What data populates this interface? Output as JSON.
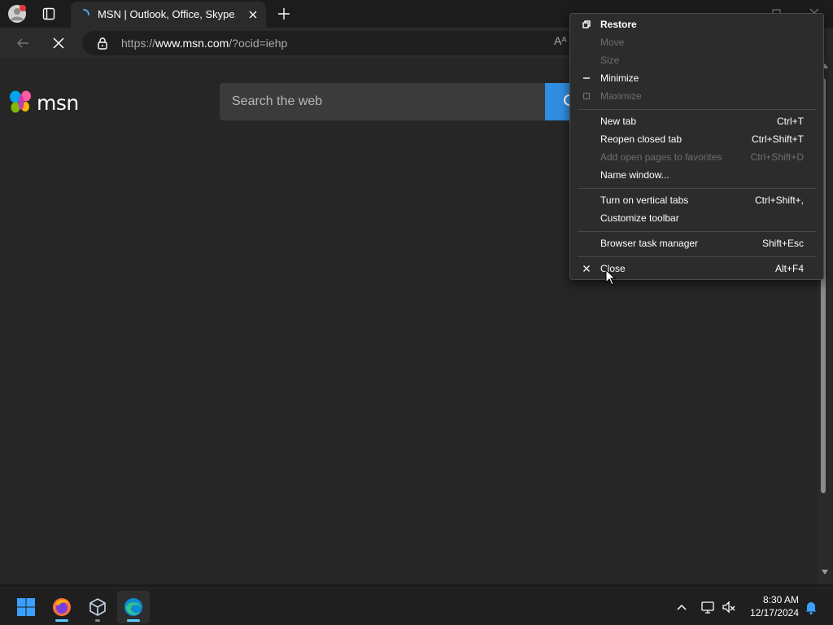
{
  "browser": {
    "tab": {
      "title": "MSN | Outlook, Office, Skype, Bing"
    },
    "address": {
      "prefix": "https://",
      "domain": "www.msn.com",
      "path": "/?ocid=iehp"
    },
    "read_aloud_glyph": "Aᴬ"
  },
  "page": {
    "logo_text": "msn",
    "search_placeholder": "Search the web"
  },
  "context_menu": {
    "restore": "Restore",
    "move": "Move",
    "size": "Size",
    "minimize": "Minimize",
    "maximize": "Maximize",
    "new_tab": {
      "label": "New tab",
      "shortcut": "Ctrl+T"
    },
    "reopen_closed_tab": {
      "label": "Reopen closed tab",
      "shortcut": "Ctrl+Shift+T"
    },
    "add_open_pages": {
      "label": "Add open pages to favorites",
      "shortcut": "Ctrl+Shift+D"
    },
    "name_window": {
      "label": "Name window..."
    },
    "vertical_tabs": {
      "label": "Turn on vertical tabs",
      "shortcut": "Ctrl+Shift+,"
    },
    "customize_toolbar": {
      "label": "Customize toolbar"
    },
    "task_manager": {
      "label": "Browser task manager",
      "shortcut": "Shift+Esc"
    },
    "close": {
      "label": "Close",
      "shortcut": "Alt+F4"
    }
  },
  "taskbar": {
    "apps": [
      "start-button",
      "firefox",
      "virtualbox",
      "edge"
    ],
    "time": "8:30 AM",
    "date": "12/17/2024"
  },
  "colors": {
    "accent_blue": "#2f8ee0",
    "edge_indicator": "#60cdff",
    "disabled_text": "#6e6e6e"
  }
}
